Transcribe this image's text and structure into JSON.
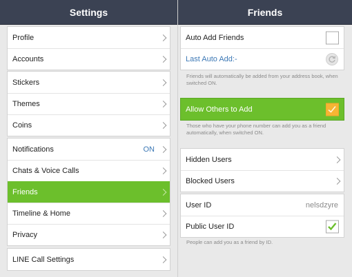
{
  "settings": {
    "title": "Settings",
    "group1": [
      "Profile",
      "Accounts"
    ],
    "group2": [
      "Stickers",
      "Themes",
      "Coins"
    ],
    "group3": [
      {
        "label": "Notifications",
        "value": "ON"
      },
      {
        "label": "Chats & Voice Calls"
      },
      {
        "label": "Friends"
      },
      {
        "label": "Timeline & Home"
      },
      {
        "label": "Privacy"
      }
    ],
    "group4": [
      "LINE Call Settings"
    ]
  },
  "friends": {
    "title": "Friends",
    "auto_add": "Auto Add Friends",
    "last_auto_add": "Last Auto Add:-",
    "auto_add_note": "Friends will automatically be added from your address book, when switched ON.",
    "allow_others": "Allow Others to Add",
    "allow_note": "Those who have your phone number can add you as a friend automatically, when switched ON.",
    "hidden_users": "Hidden Users",
    "blocked_users": "Blocked Users",
    "user_id_label": "User ID",
    "user_id_value": "nelsdzyre",
    "public_user_id": "Public User ID",
    "public_note": "People can add you as a friend by ID."
  },
  "colors": {
    "header": "#3b4253",
    "selected": "#6cbf2c",
    "accent_blue": "#3c78b5",
    "checkbox_orange": "#f7b533",
    "check_green": "#6cbf2c"
  },
  "icons": {
    "chevron": "chevron-right-icon",
    "refresh": "refresh-icon",
    "check": "check-icon"
  }
}
